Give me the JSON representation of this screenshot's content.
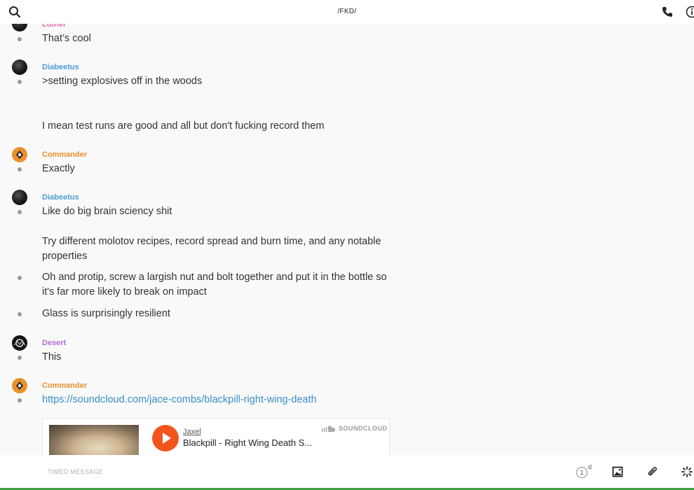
{
  "header": {
    "title": "/FKD/",
    "icons": {
      "search": "search-icon",
      "call": "phone-icon",
      "info": "info-icon"
    }
  },
  "messages": [
    {
      "author": "Luther",
      "author_color": "#e46fa8",
      "lines": [
        "That’s cool"
      ]
    },
    {
      "author": "Diabeetus",
      "author_color": "#4a9fd8",
      "lines": [
        ">setting explosives off in the woods",
        "I mean test runs are good and all but don't fucking record them"
      ]
    },
    {
      "author": "Commander",
      "author_color": "#e8912c",
      "lines": [
        "Exactly"
      ]
    },
    {
      "author": "Diabeetus",
      "author_color": "#4a9fd8",
      "lines": [
        "Like do big brain sciency shit",
        "Try different molotov recipes, record spread and burn time, and any notable properties",
        "Oh and protip, screw a largish nut and bolt together and put it in the bottle so it's far more likely to break on impact",
        "Glass is surprisingly resilient"
      ]
    },
    {
      "author": "Desert",
      "author_color": "#b56ad6",
      "lines": [
        "This"
      ]
    },
    {
      "author": "Commander",
      "author_color": "#e8912c",
      "lines": [
        "https://soundcloud.com/jace-combs/blackpill-right-wing-death"
      ]
    }
  ],
  "embed": {
    "provider": "SOUNDCLOUD",
    "artist": "Jaxel",
    "track": "Blackpill - Right Wing Death S...",
    "accent": "#f2541b"
  },
  "composer": {
    "placeholder": "TIMED MESSAGE",
    "timer_value": "1",
    "timer_unit": "d",
    "icons": [
      "image-icon",
      "paperclip-icon",
      "loading-spinner-icon"
    ]
  }
}
